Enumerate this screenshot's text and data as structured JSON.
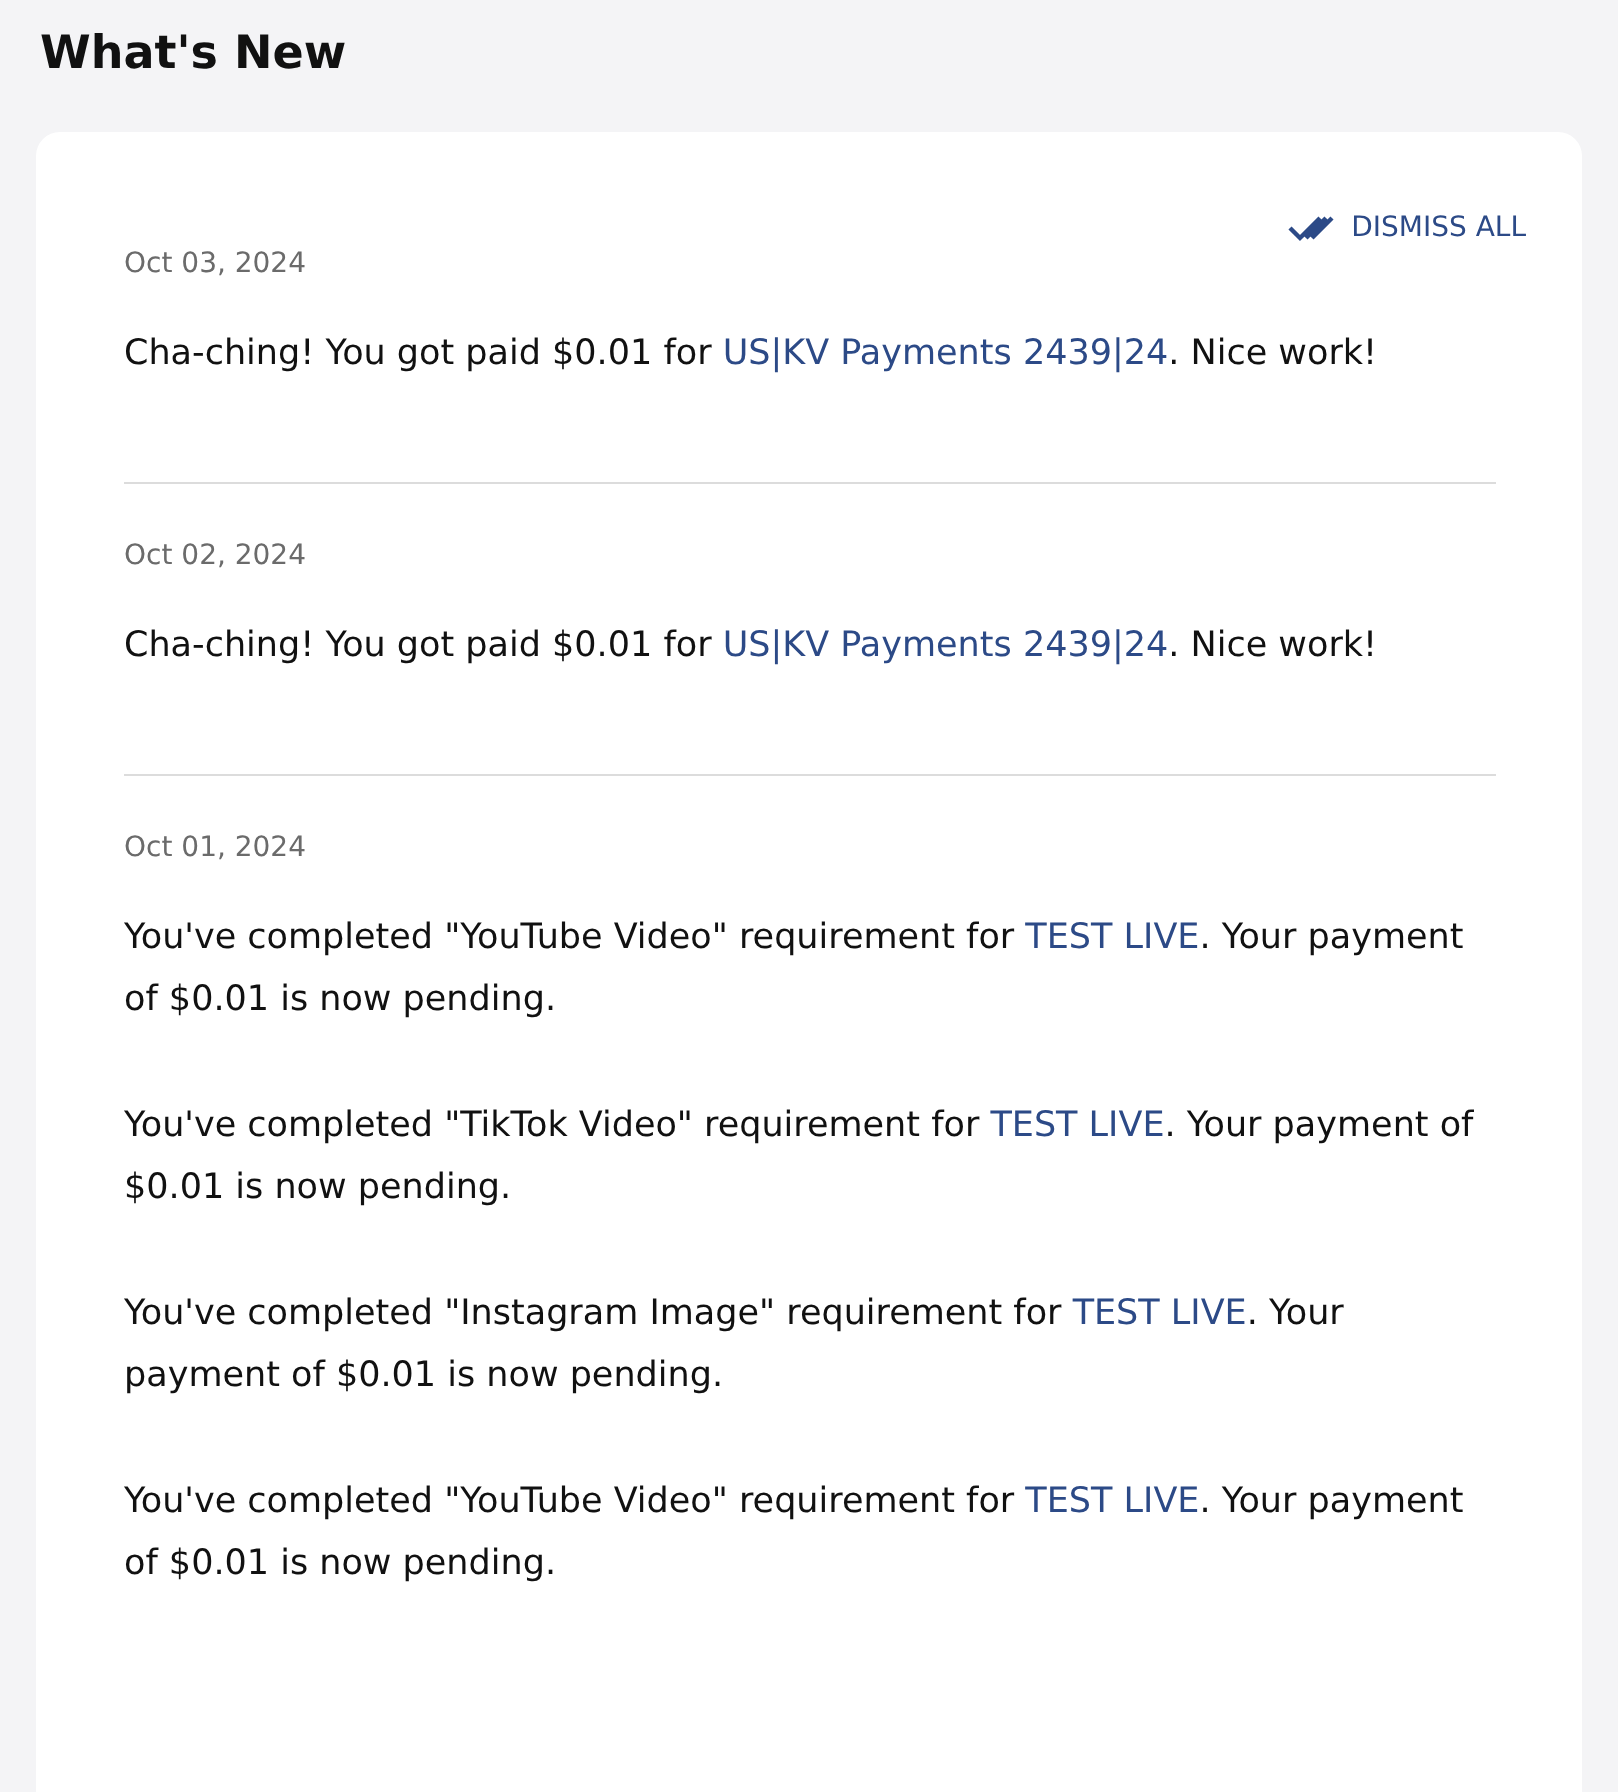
{
  "title": "What's New",
  "dismiss_all": "DISMISS ALL",
  "groups": [
    {
      "date": "Oct 03, 2024",
      "messages": [
        {
          "before": "Cha-ching! You got paid $0.01 for ",
          "link": "US|KV Payments 2439|24",
          "after": ". Nice work!"
        }
      ]
    },
    {
      "date": "Oct 02, 2024",
      "messages": [
        {
          "before": "Cha-ching! You got paid $0.01 for ",
          "link": "US|KV Payments 2439|24",
          "after": ". Nice work!"
        }
      ]
    },
    {
      "date": "Oct 01, 2024",
      "messages": [
        {
          "before": "You've completed \"YouTube Video\" requirement for ",
          "link": "TEST LIVE",
          "after": ". Your payment of $0.01 is now pending."
        },
        {
          "before": "You've completed \"TikTok Video\" requirement for ",
          "link": "TEST LIVE",
          "after": ". Your payment of $0.01 is now pending."
        },
        {
          "before": "You've completed \"Instagram Image\" requirement for ",
          "link": "TEST LIVE",
          "after": ". Your payment of $0.01 is now pending."
        },
        {
          "before": "You've completed \"YouTube Video\" requirement for ",
          "link": "TEST LIVE",
          "after": ". Your payment of $0.01 is now pending."
        }
      ]
    }
  ]
}
